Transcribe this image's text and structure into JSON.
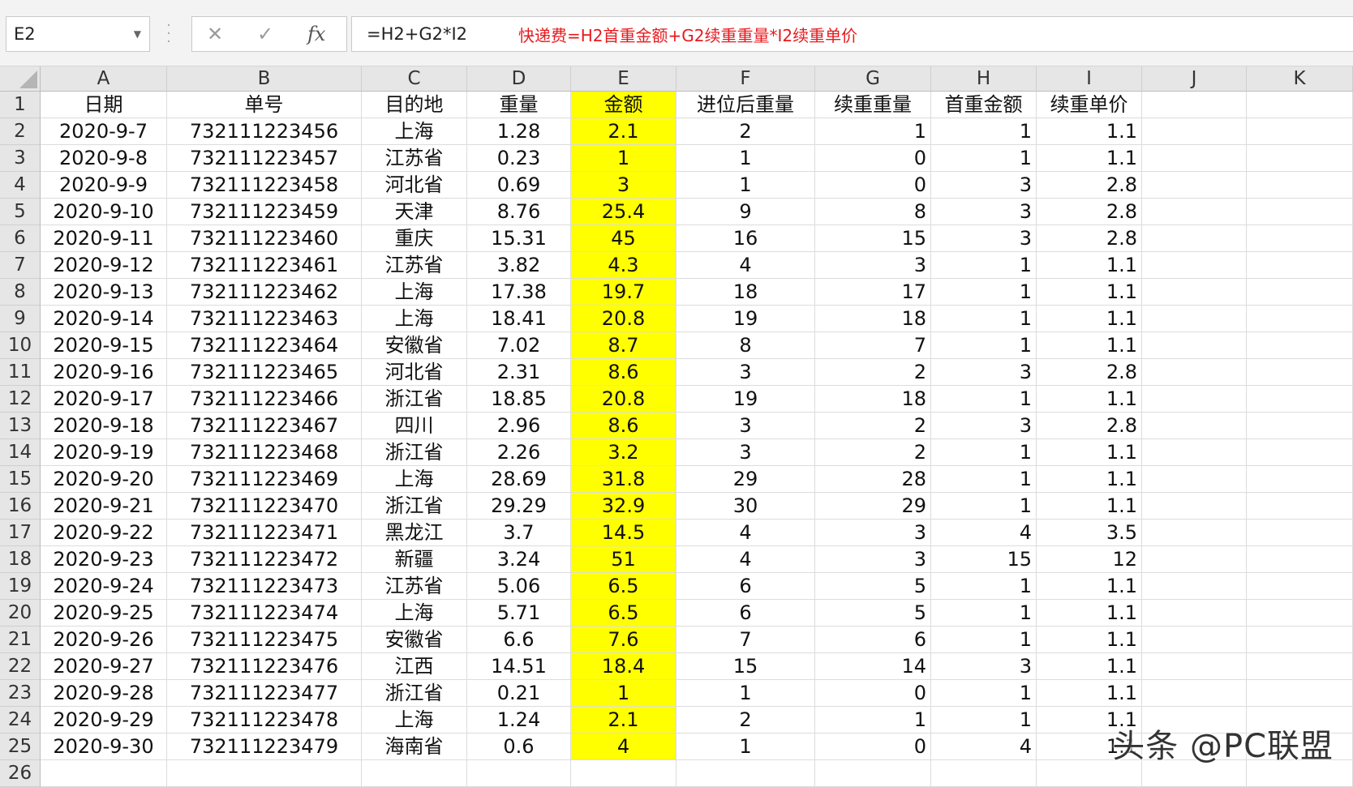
{
  "name_box": {
    "value": "E2",
    "dropdown_icon": "chevron-down-icon"
  },
  "formula_bar": {
    "cancel_icon": "✕",
    "enter_icon": "✓",
    "fx_icon": "fx",
    "formula": "=H2+G2*I2",
    "note": "快递费=H2首重金额+G2续重重量*I2续重单价"
  },
  "colors": {
    "highlight": "#ffff00",
    "note": "#e8191d"
  },
  "columns": [
    "A",
    "B",
    "C",
    "D",
    "E",
    "F",
    "G",
    "H",
    "I",
    "J",
    "K"
  ],
  "header": [
    "日期",
    "单号",
    "目的地",
    "重量",
    "金额",
    "进位后重量",
    "续重重量",
    "首重金额",
    "续重单价"
  ],
  "rows": [
    [
      "2020-9-7",
      "732111223456",
      "上海",
      "1.28",
      "2.1",
      "2",
      "1",
      "1",
      "1.1"
    ],
    [
      "2020-9-8",
      "732111223457",
      "江苏省",
      "0.23",
      "1",
      "1",
      "0",
      "1",
      "1.1"
    ],
    [
      "2020-9-9",
      "732111223458",
      "河北省",
      "0.69",
      "3",
      "1",
      "0",
      "3",
      "2.8"
    ],
    [
      "2020-9-10",
      "732111223459",
      "天津",
      "8.76",
      "25.4",
      "9",
      "8",
      "3",
      "2.8"
    ],
    [
      "2020-9-11",
      "732111223460",
      "重庆",
      "15.31",
      "45",
      "16",
      "15",
      "3",
      "2.8"
    ],
    [
      "2020-9-12",
      "732111223461",
      "江苏省",
      "3.82",
      "4.3",
      "4",
      "3",
      "1",
      "1.1"
    ],
    [
      "2020-9-13",
      "732111223462",
      "上海",
      "17.38",
      "19.7",
      "18",
      "17",
      "1",
      "1.1"
    ],
    [
      "2020-9-14",
      "732111223463",
      "上海",
      "18.41",
      "20.8",
      "19",
      "18",
      "1",
      "1.1"
    ],
    [
      "2020-9-15",
      "732111223464",
      "安徽省",
      "7.02",
      "8.7",
      "8",
      "7",
      "1",
      "1.1"
    ],
    [
      "2020-9-16",
      "732111223465",
      "河北省",
      "2.31",
      "8.6",
      "3",
      "2",
      "3",
      "2.8"
    ],
    [
      "2020-9-17",
      "732111223466",
      "浙江省",
      "18.85",
      "20.8",
      "19",
      "18",
      "1",
      "1.1"
    ],
    [
      "2020-9-18",
      "732111223467",
      "四川",
      "2.96",
      "8.6",
      "3",
      "2",
      "3",
      "2.8"
    ],
    [
      "2020-9-19",
      "732111223468",
      "浙江省",
      "2.26",
      "3.2",
      "3",
      "2",
      "1",
      "1.1"
    ],
    [
      "2020-9-20",
      "732111223469",
      "上海",
      "28.69",
      "31.8",
      "29",
      "28",
      "1",
      "1.1"
    ],
    [
      "2020-9-21",
      "732111223470",
      "浙江省",
      "29.29",
      "32.9",
      "30",
      "29",
      "1",
      "1.1"
    ],
    [
      "2020-9-22",
      "732111223471",
      "黑龙江",
      "3.7",
      "14.5",
      "4",
      "3",
      "4",
      "3.5"
    ],
    [
      "2020-9-23",
      "732111223472",
      "新疆",
      "3.24",
      "51",
      "4",
      "3",
      "15",
      "12"
    ],
    [
      "2020-9-24",
      "732111223473",
      "江苏省",
      "5.06",
      "6.5",
      "6",
      "5",
      "1",
      "1.1"
    ],
    [
      "2020-9-25",
      "732111223474",
      "上海",
      "5.71",
      "6.5",
      "6",
      "5",
      "1",
      "1.1"
    ],
    [
      "2020-9-26",
      "732111223475",
      "安徽省",
      "6.6",
      "7.6",
      "7",
      "6",
      "1",
      "1.1"
    ],
    [
      "2020-9-27",
      "732111223476",
      "江西",
      "14.51",
      "18.4",
      "15",
      "14",
      "3",
      "1.1"
    ],
    [
      "2020-9-28",
      "732111223477",
      "浙江省",
      "0.21",
      "1",
      "1",
      "0",
      "1",
      "1.1"
    ],
    [
      "2020-9-29",
      "732111223478",
      "上海",
      "1.24",
      "2.1",
      "2",
      "1",
      "1",
      "1.1"
    ],
    [
      "2020-9-30",
      "732111223479",
      "海南省",
      "0.6",
      "4",
      "1",
      "0",
      "4",
      "1.1"
    ]
  ],
  "watermark": "头条 @PC联盟"
}
